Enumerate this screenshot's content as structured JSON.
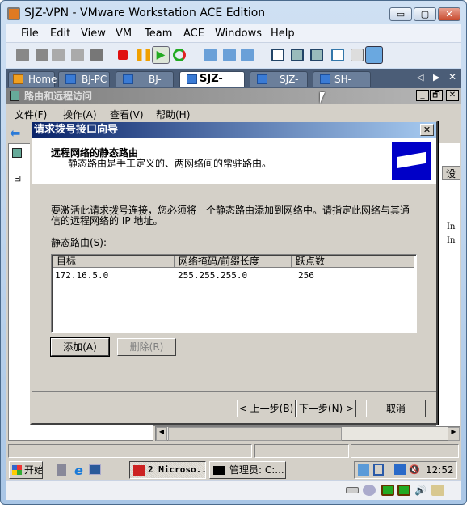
{
  "window": {
    "title": "SJZ-VPN - VMware Workstation ACE Edition",
    "minimize": "▭",
    "restore": "▢",
    "close": "✕"
  },
  "menu": [
    "File",
    "Edit",
    "View",
    "VM",
    "Team",
    "ACE",
    "Windows",
    "Help"
  ],
  "tabs": [
    {
      "label": "Home"
    },
    {
      "label": "BJ-PC"
    },
    {
      "label": "BJ-VPN"
    },
    {
      "label": "SJZ-VPN",
      "active": true
    },
    {
      "label": "SJZ-PC"
    },
    {
      "label": "SH-VPN"
    }
  ],
  "tab_nav": {
    "prev": "◁",
    "next": "▶",
    "close": "✕"
  },
  "mmc": {
    "title": "路由和远程访问",
    "menu": [
      "文件(F)",
      "操作(A)",
      "查看(V)",
      "帮助(H)"
    ],
    "right_col_header": "设",
    "right_rows": [
      "In",
      "In"
    ],
    "tree_toggle": "⊟",
    "min": "_",
    "restore": "🗗",
    "close": "✕"
  },
  "dialog": {
    "title": "请求拨号接口向导",
    "close": "✕",
    "header_title": "远程网络的静态路由",
    "header_subtitle": "静态路由是手工定义的、两网络间的常驻路由。",
    "instructions": "要激活此请求拨号连接，您必须将一个静态路由添加到网络中。请指定此网络与其通信的远程网络的 IP 地址。",
    "list_label": "静态路由(S):",
    "columns": [
      "目标",
      "网络掩码/前缀长度",
      "跃点数"
    ],
    "rows": [
      [
        "172.16.5.0",
        "255.255.255.0",
        "256"
      ]
    ],
    "add_button": "添加(A)",
    "delete_button": "删除(R)",
    "back_button": "< 上一步(B)",
    "next_button": "下一步(N) >",
    "cancel_button": "取消"
  },
  "taskbar": {
    "start": "开始",
    "task1": "2 Microso...",
    "task2": "管理员: C:...",
    "clock": "12:52"
  },
  "colors": {
    "dialog_title_start": "#0a246a",
    "dialog_title_end": "#a6caf0",
    "window_frame": "#a9c6e6",
    "classic_face": "#d4d0c8"
  }
}
